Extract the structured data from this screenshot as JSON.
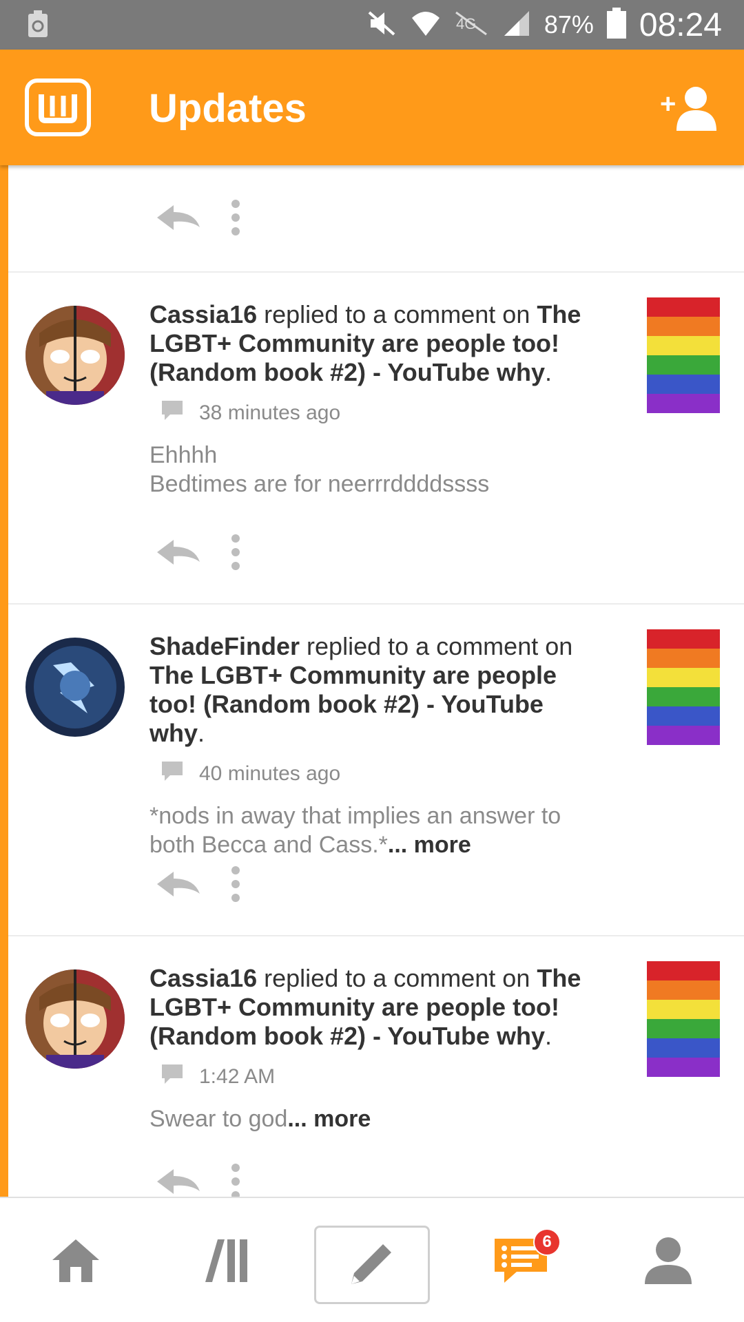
{
  "status_bar": {
    "battery": "87%",
    "time": "08:24"
  },
  "app_bar": {
    "title": "Updates"
  },
  "feed": {
    "items": [
      {
        "user": "Cassia16",
        "action": " replied to a comment on ",
        "story": "The LGBT+ Community are people too! (Random book #2) - YouTube why",
        "period": ".",
        "time": "38 minutes ago",
        "text_line1": "Ehhhh",
        "text_line2": "Bedtimes are for neerrrddddssss",
        "more": ""
      },
      {
        "user": "ShadeFinder",
        "action": " replied to a comment on ",
        "story": "The LGBT+ Community are people too! (Random book #2) - YouTube why",
        "period": ".",
        "time": "40 minutes ago",
        "text_line1": "*nods in away that implies an answer to",
        "text_line2": "both Becca and Cass.*",
        "more": "... more"
      },
      {
        "user": "Cassia16",
        "action": " replied to a comment on ",
        "story": "The LGBT+ Community are people too! (Random book #2) - YouTube why",
        "period": ".",
        "time": "1:42 AM",
        "text_line1": "Swear to god",
        "text_line2": "",
        "more": "... more"
      }
    ]
  },
  "bottom_nav": {
    "notifications_badge": "6"
  },
  "colors": {
    "accent": "#ff9a19",
    "badge": "#e8352e"
  },
  "icons": [
    "wattpad-logo-icon",
    "add-user-icon",
    "reply-icon",
    "more-vert-icon",
    "comment-icon",
    "home-icon",
    "library-icon",
    "write-icon",
    "notifications-icon",
    "profile-icon"
  ]
}
